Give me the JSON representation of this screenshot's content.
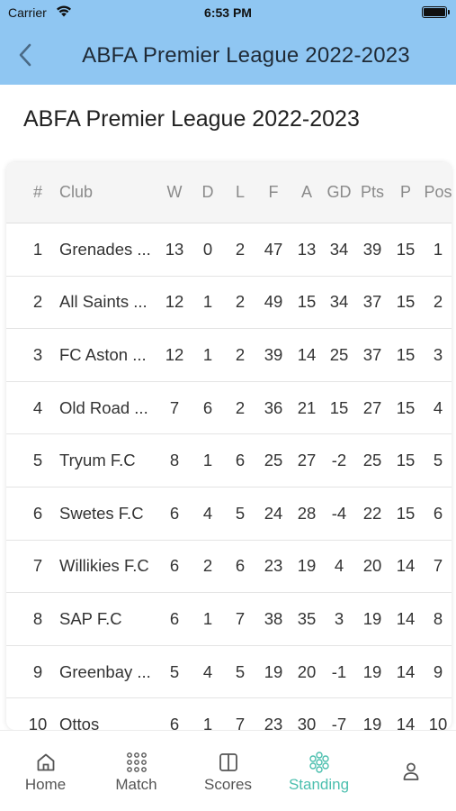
{
  "status_bar": {
    "carrier": "Carrier",
    "time": "6:53 PM"
  },
  "nav": {
    "title": "ABFA Premier League 2022-2023"
  },
  "page": {
    "title": "ABFA Premier League 2022-2023"
  },
  "table": {
    "headers": {
      "num": "#",
      "club": "Club",
      "w": "W",
      "d": "D",
      "l": "L",
      "f": "F",
      "a": "A",
      "gd": "GD",
      "pts": "Pts",
      "p": "P",
      "pos": "Pos"
    },
    "rows": [
      {
        "num": "1",
        "club": "Grenades ...",
        "w": "13",
        "d": "0",
        "l": "2",
        "f": "47",
        "a": "13",
        "gd": "34",
        "pts": "39",
        "p": "15",
        "pos": "1"
      },
      {
        "num": "2",
        "club": "All Saints ...",
        "w": "12",
        "d": "1",
        "l": "2",
        "f": "49",
        "a": "15",
        "gd": "34",
        "pts": "37",
        "p": "15",
        "pos": "2"
      },
      {
        "num": "3",
        "club": "FC Aston ...",
        "w": "12",
        "d": "1",
        "l": "2",
        "f": "39",
        "a": "14",
        "gd": "25",
        "pts": "37",
        "p": "15",
        "pos": "3"
      },
      {
        "num": "4",
        "club": "Old Road ...",
        "w": "7",
        "d": "6",
        "l": "2",
        "f": "36",
        "a": "21",
        "gd": "15",
        "pts": "27",
        "p": "15",
        "pos": "4"
      },
      {
        "num": "5",
        "club": "Tryum F.C",
        "w": "8",
        "d": "1",
        "l": "6",
        "f": "25",
        "a": "27",
        "gd": "-2",
        "pts": "25",
        "p": "15",
        "pos": "5"
      },
      {
        "num": "6",
        "club": "Swetes F.C",
        "w": "6",
        "d": "4",
        "l": "5",
        "f": "24",
        "a": "28",
        "gd": "-4",
        "pts": "22",
        "p": "15",
        "pos": "6"
      },
      {
        "num": "7",
        "club": "Willikies F.C",
        "w": "6",
        "d": "2",
        "l": "6",
        "f": "23",
        "a": "19",
        "gd": "4",
        "pts": "20",
        "p": "14",
        "pos": "7"
      },
      {
        "num": "8",
        "club": "SAP F.C",
        "w": "6",
        "d": "1",
        "l": "7",
        "f": "38",
        "a": "35",
        "gd": "3",
        "pts": "19",
        "p": "14",
        "pos": "8"
      },
      {
        "num": "9",
        "club": "Greenbay ...",
        "w": "5",
        "d": "4",
        "l": "5",
        "f": "19",
        "a": "20",
        "gd": "-1",
        "pts": "19",
        "p": "14",
        "pos": "9"
      },
      {
        "num": "10",
        "club": "Ottos",
        "w": "6",
        "d": "1",
        "l": "7",
        "f": "23",
        "a": "30",
        "gd": "-7",
        "pts": "19",
        "p": "14",
        "pos": "10"
      }
    ]
  },
  "tabbar": {
    "active_color": "#4bbfae",
    "tabs": [
      {
        "label": "Home",
        "icon": "home-icon"
      },
      {
        "label": "Match",
        "icon": "grid-dots-icon"
      },
      {
        "label": "Scores",
        "icon": "columns-icon"
      },
      {
        "label": "Standing",
        "icon": "standing-icon",
        "active": true
      },
      {
        "label": "",
        "icon": "profile-icon"
      }
    ]
  }
}
